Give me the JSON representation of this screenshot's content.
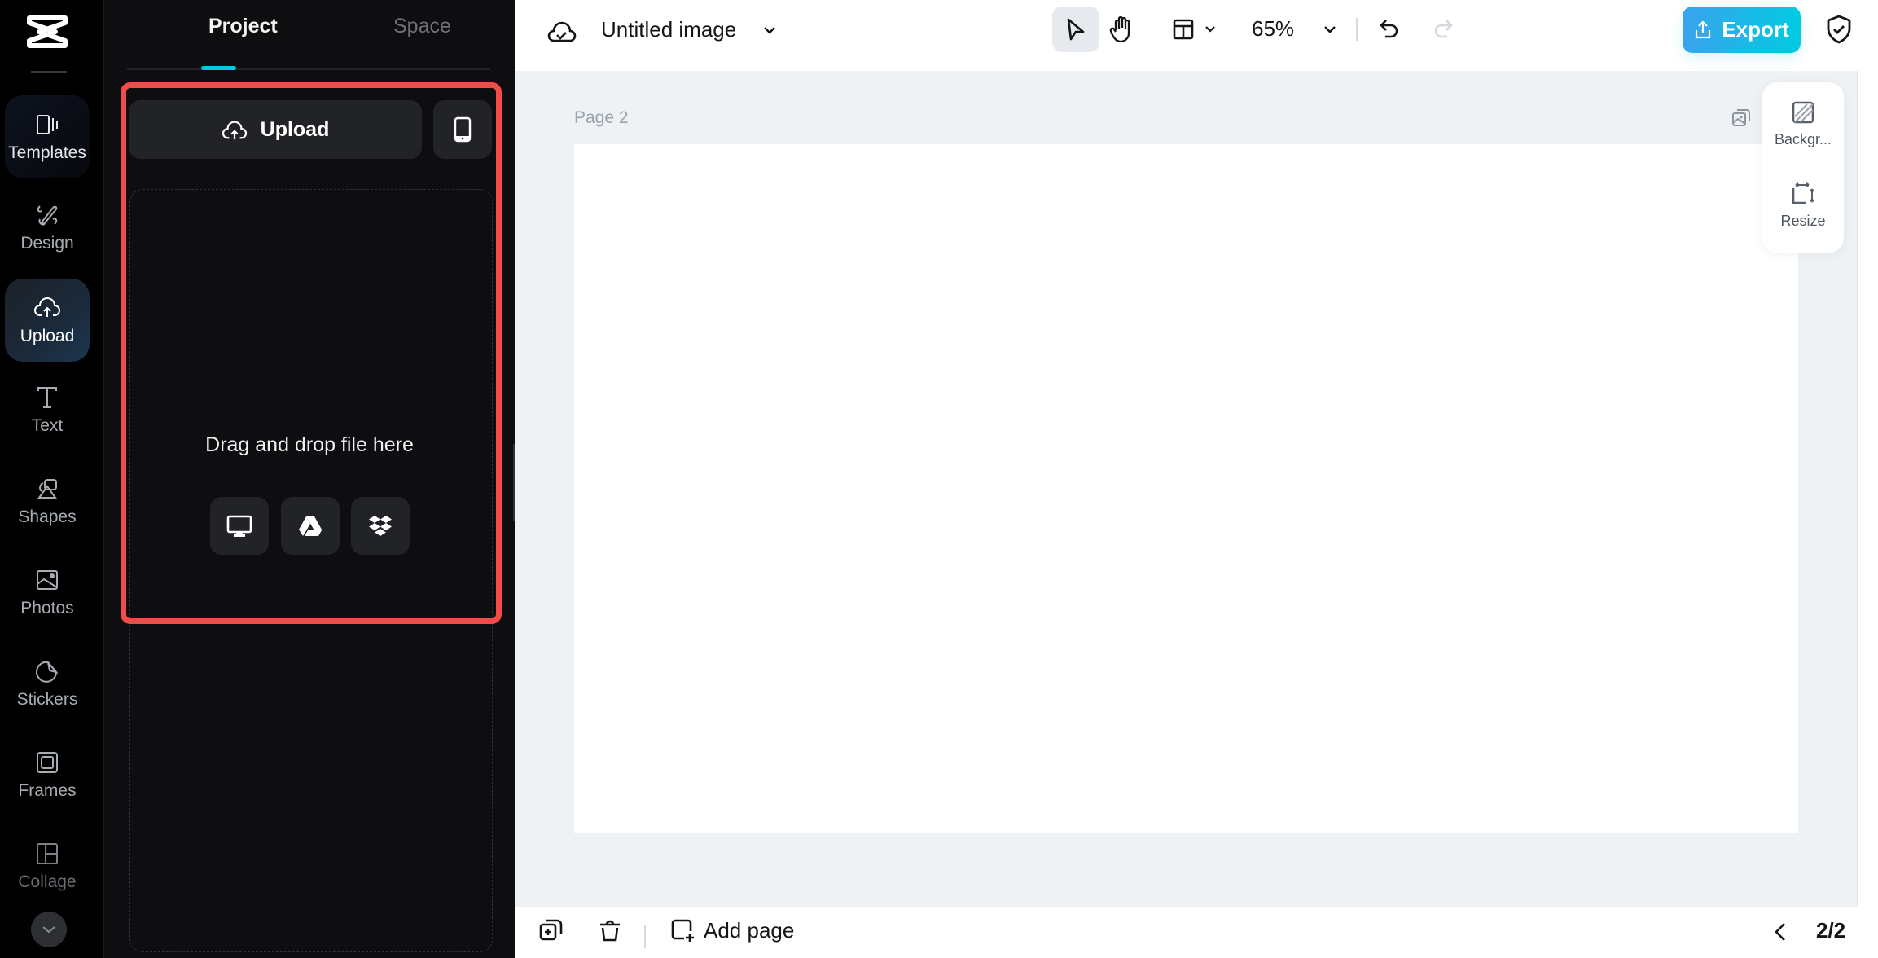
{
  "rail": {
    "items": [
      {
        "label": "Templates",
        "icon": "templates-icon"
      },
      {
        "label": "Design",
        "icon": "design-icon"
      },
      {
        "label": "Upload",
        "icon": "upload-cloud-icon"
      },
      {
        "label": "Text",
        "icon": "text-icon"
      },
      {
        "label": "Shapes",
        "icon": "shapes-icon"
      },
      {
        "label": "Photos",
        "icon": "photos-icon"
      },
      {
        "label": "Stickers",
        "icon": "stickers-icon"
      },
      {
        "label": "Frames",
        "icon": "frames-icon"
      },
      {
        "label": "Collage",
        "icon": "collage-icon"
      }
    ],
    "active": "Upload"
  },
  "panel": {
    "tabs": [
      {
        "label": "Project",
        "active": true
      },
      {
        "label": "Space",
        "active": false
      }
    ],
    "upload_label": "Upload",
    "drop_text": "Drag and drop file here",
    "sources": [
      "computer-icon",
      "google-drive-icon",
      "dropbox-icon"
    ],
    "highlight_color": "#f24b4a"
  },
  "topbar": {
    "title": "Untitled image",
    "zoom": "65%",
    "export_label": "Export",
    "accent": "#00cbe0"
  },
  "canvas": {
    "page_label": "Page 2",
    "tools": [
      {
        "label": "Backgr..."
      },
      {
        "label": "Resize"
      }
    ]
  },
  "bottombar": {
    "add_page_label": "Add page",
    "page_counter": "2/2"
  }
}
